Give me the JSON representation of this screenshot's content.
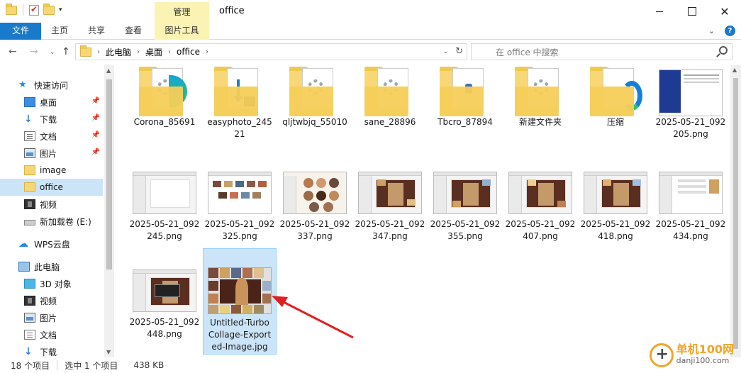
{
  "title_bar": {
    "manage_tab": "管理",
    "window_title": "office",
    "minimize": "—",
    "maximize": "☐",
    "close": "✕"
  },
  "ribbon": {
    "tabs": [
      "文件",
      "主页",
      "共享",
      "查看",
      "图片工具"
    ],
    "file_tab_color": "#1979ca",
    "context_tab_color": "#fbf3b4"
  },
  "address": {
    "crumbs": [
      "此电脑",
      "桌面",
      "office"
    ],
    "search_placeholder": "在 office 中搜索"
  },
  "nav_pane": {
    "items": [
      {
        "label": "快速访问",
        "icon": "star-icon"
      },
      {
        "label": "桌面",
        "icon": "desktop-icon",
        "pinned": true
      },
      {
        "label": "下载",
        "icon": "download-icon",
        "pinned": true
      },
      {
        "label": "文档",
        "icon": "document-icon",
        "pinned": true
      },
      {
        "label": "图片",
        "icon": "picture-icon",
        "pinned": true
      },
      {
        "label": "image",
        "icon": "folder-icon"
      },
      {
        "label": "office",
        "icon": "folder-icon",
        "selected": true
      },
      {
        "label": "视频",
        "icon": "video-icon"
      },
      {
        "label": "新加载卷 (E:)",
        "icon": "drive-icon"
      },
      {
        "label": "WPS云盘",
        "icon": "cloud-icon"
      },
      {
        "label": "此电脑",
        "icon": "pc-icon"
      },
      {
        "label": "3D 对象",
        "icon": "3d-objects-icon"
      },
      {
        "label": "视频",
        "icon": "video-icon"
      },
      {
        "label": "图片",
        "icon": "picture-icon"
      },
      {
        "label": "文档",
        "icon": "document-icon"
      },
      {
        "label": "下载",
        "icon": "download-icon"
      }
    ]
  },
  "files": [
    {
      "name": "Corona_85691",
      "kind": "folder",
      "variant": "gear-swirl"
    },
    {
      "name": "easyphoto_245\n21",
      "kind": "folder",
      "variant": "download"
    },
    {
      "name": "qljtwbjq_55010",
      "kind": "folder",
      "variant": "gear"
    },
    {
      "name": "sane_28896",
      "kind": "folder",
      "variant": "gear"
    },
    {
      "name": "Tbcro_87894",
      "kind": "folder",
      "variant": "logo"
    },
    {
      "name": "新建文件夹",
      "kind": "folder",
      "variant": "gear"
    },
    {
      "name": "压缩",
      "kind": "folder",
      "variant": "edge"
    },
    {
      "name": "2025-05-21_092\n205.png",
      "kind": "image",
      "variant": "setup"
    },
    {
      "name": "2025-05-21_092\n245.png",
      "kind": "image",
      "variant": "blank"
    },
    {
      "name": "2025-05-21_092\n325.png",
      "kind": "image",
      "variant": "tiles"
    },
    {
      "name": "2025-05-21_092\n337.png",
      "kind": "image",
      "variant": "circles"
    },
    {
      "name": "2025-05-21_092\n347.png",
      "kind": "image",
      "variant": "collage"
    },
    {
      "name": "2025-05-21_092\n355.png",
      "kind": "image",
      "variant": "collage"
    },
    {
      "name": "2025-05-21_092\n407.png",
      "kind": "image",
      "variant": "collage"
    },
    {
      "name": "2025-05-21_092\n418.png",
      "kind": "image",
      "variant": "collage"
    },
    {
      "name": "2025-05-21_092\n434.png",
      "kind": "image",
      "variant": "list"
    },
    {
      "name": "2025-05-21_092\n448.png",
      "kind": "image",
      "variant": "dialog"
    },
    {
      "name": "Untitled-Turbo\nCollage-Export\ned-Image.jpg",
      "kind": "image",
      "variant": "collage-big",
      "selected": true
    }
  ],
  "status": {
    "count": "18 个项目",
    "selection": "选中 1 个项目",
    "size": "438 KB"
  },
  "watermark": {
    "brand": "单机100网",
    "url": "danji100.com"
  },
  "colors": {
    "selection": "#cce4f7",
    "selection_border": "#99d1ff",
    "arrow": "#e02020"
  }
}
